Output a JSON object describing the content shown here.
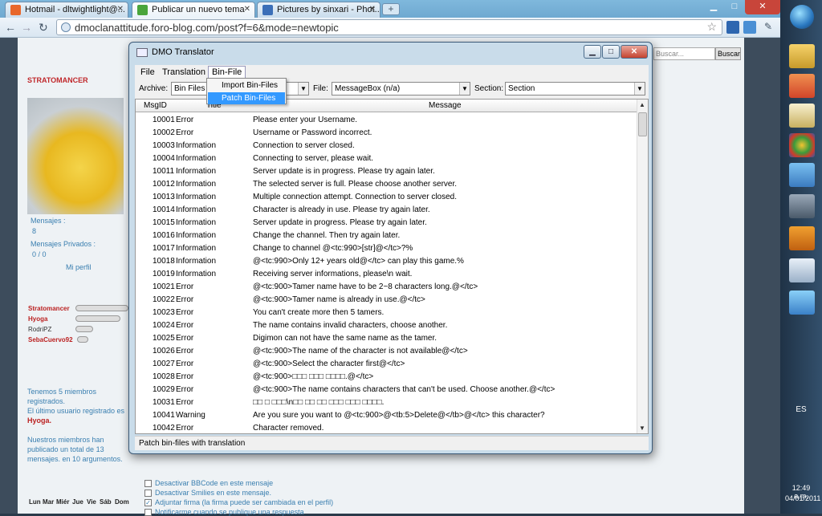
{
  "browser": {
    "tabs": [
      {
        "title": "Hotmail - dltwightlight@...",
        "color": "#e8672b"
      },
      {
        "title": "Publicar un nuevo tema",
        "color": "#4aa53c"
      },
      {
        "title": "Pictures by sinxari - Phot...",
        "color": "#3b6fb8"
      }
    ],
    "url": "dmoclanattitude.foro-blog.com/post?f=6&mode=newtopic"
  },
  "forum": {
    "username": "STRATOMANCER",
    "messages_label": "Mensajes :",
    "messages_count": "8",
    "private_label": "Mensajes Privados :",
    "private_count": "0 / 0",
    "profile_link": "Mi perfil",
    "online_users": [
      "Stratomancer",
      "Hyoga",
      "RodriPZ",
      "SebaCuervo92"
    ],
    "stats": [
      "Tenemos 5 miembros",
      "registrados.",
      "El último usuario registrado es",
      "Hyoga.",
      "Nuestros miembros han",
      "publicado un total de 13",
      "mensajes. en 10 argumentos."
    ],
    "search_placeholder": "Buscar...",
    "search_button": "Buscar",
    "options": [
      "Desactivar BBCode en este mensaje",
      "Desactivar Smilies en este mensaje.",
      "Adjuntar firma (la firma puede ser cambiada en el perfil)",
      "Notificarme cuando se publique una respuesta"
    ],
    "calendar_days": [
      "Lun",
      "Mar",
      "Miér",
      "Jue",
      "Vie",
      "Sáb",
      "Dom"
    ]
  },
  "dialog": {
    "title": "DMO Translator",
    "menu": [
      "File",
      "Translation",
      "Bin-File"
    ],
    "dropdown": [
      "Import Bin-Files",
      "Patch Bin-Files"
    ],
    "archive_label": "Archive:",
    "archive_value": "Bin Files",
    "file_label": "File:",
    "file_value": "MessageBox (n/a)",
    "section_label": "Section:",
    "section_value": "Section",
    "columns": [
      "MsgID",
      "Title",
      "Message"
    ],
    "rows": [
      {
        "id": "10001",
        "title": "Error",
        "msg": "Please enter your Username."
      },
      {
        "id": "10002",
        "title": "Error",
        "msg": "Username or Password incorrect."
      },
      {
        "id": "10003",
        "title": "Information",
        "msg": "Connection to server closed."
      },
      {
        "id": "10004",
        "title": "Information",
        "msg": "Connecting to server, please wait."
      },
      {
        "id": "10011",
        "title": "Information",
        "msg": "Server update is in progress. Please try again later."
      },
      {
        "id": "10012",
        "title": "Information",
        "msg": "The selected server is full. Please choose another server."
      },
      {
        "id": "10013",
        "title": "Information",
        "msg": "Multiple connection attempt. Connection to server closed."
      },
      {
        "id": "10014",
        "title": "Information",
        "msg": "Character is already in use. Please try again later."
      },
      {
        "id": "10015",
        "title": "Information",
        "msg": "Server update in progress. Please try again later."
      },
      {
        "id": "10016",
        "title": "Information",
        "msg": "Change the channel. Then try again later."
      },
      {
        "id": "10017",
        "title": "Information",
        "msg": "Change to channel @<tc:990>[str]@</tc>?%"
      },
      {
        "id": "10018",
        "title": "Information",
        "msg": "@<tc:990>Only 12+ years old@</tc> can play this game.%"
      },
      {
        "id": "10019",
        "title": "Information",
        "msg": "Receiving server informations, please\\n wait."
      },
      {
        "id": "10021",
        "title": "Error",
        "msg": "@<tc:900>Tamer name have to be 2~8 characters long.@</tc>"
      },
      {
        "id": "10022",
        "title": "Error",
        "msg": "@<tc:900>Tamer name is already in use.@</tc>"
      },
      {
        "id": "10023",
        "title": "Error",
        "msg": "You can't create more then 5 tamers."
      },
      {
        "id": "10024",
        "title": "Error",
        "msg": "The name contains invalid characters, choose another."
      },
      {
        "id": "10025",
        "title": "Error",
        "msg": "Digimon can not have the same name as the tamer."
      },
      {
        "id": "10026",
        "title": "Error",
        "msg": "@<tc:900>The name of the character is not available@</tc>"
      },
      {
        "id": "10027",
        "title": "Error",
        "msg": "@<tc:900>Select the character first@</tc>"
      },
      {
        "id": "10028",
        "title": "Error",
        "msg": "@<tc:900>□□□ □□□ □□□□.@</tc>"
      },
      {
        "id": "10029",
        "title": "Error",
        "msg": "@<tc:900>The name contains characters that can't be used. Choose another.@</tc>"
      },
      {
        "id": "10031",
        "title": "Error",
        "msg": "□□ □ □□□\\n□□ □□ □□ □□□ □□□ □□□□."
      },
      {
        "id": "10041",
        "title": "Warning",
        "msg": "Are you sure you want to @<tc:900>@<tb:5>Delete@</tb>@</tc> this character?"
      },
      {
        "id": "10042",
        "title": "Error",
        "msg": "Character removed."
      }
    ],
    "status": "Patch bin-files with translation"
  },
  "taskbar": {
    "lang": "ES",
    "time": "12:49 a.m.",
    "date": "04/01/2011"
  }
}
